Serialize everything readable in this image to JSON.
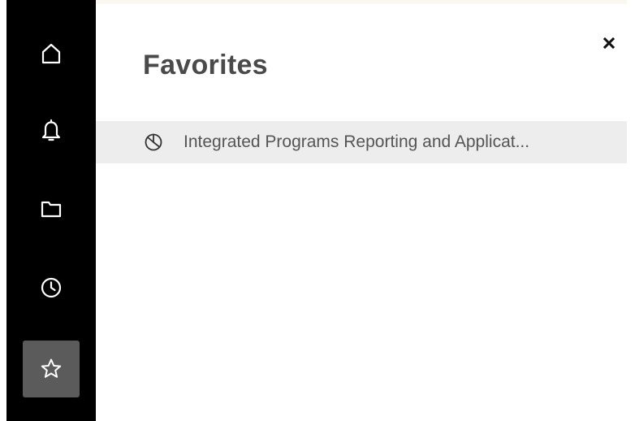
{
  "sidebar": {
    "items": [
      {
        "icon": "home-icon",
        "active": false
      },
      {
        "icon": "bell-icon",
        "active": false
      },
      {
        "icon": "folder-icon",
        "active": false
      },
      {
        "icon": "clock-icon",
        "active": false
      },
      {
        "icon": "star-icon",
        "active": true
      }
    ],
    "colors": {
      "background": "#000000",
      "active": "#5b5b5b",
      "icon": "#ffffff"
    }
  },
  "panel": {
    "title": "Favorites",
    "close_icon": "close-icon",
    "favorites": [
      {
        "icon": "report-pie-icon",
        "label": "Integrated Programs Reporting and Applicat..."
      }
    ]
  }
}
